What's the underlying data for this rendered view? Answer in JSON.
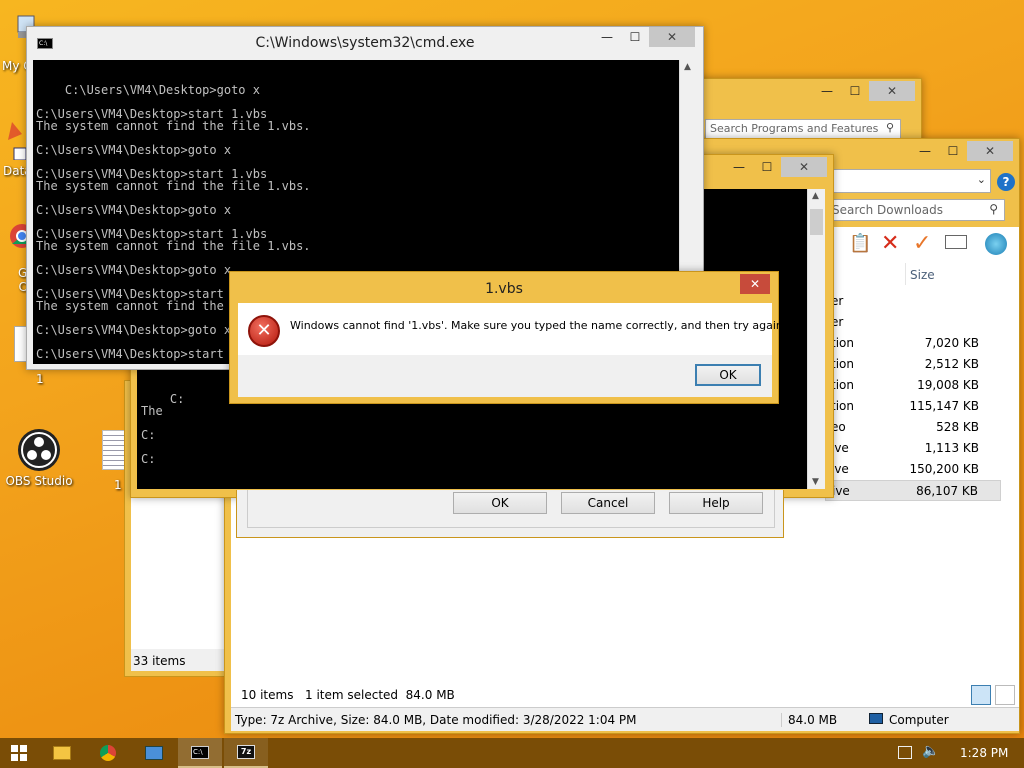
{
  "desktop": {
    "icons": [
      {
        "label": "My C",
        "icon": "computer-icon"
      },
      {
        "label": "Data",
        "icon": "shortcut-icon"
      },
      {
        "label": "G\nC",
        "icon": "chrome-icon"
      },
      {
        "label": "1",
        "icon": "file-icon"
      },
      {
        "label": "OBS Studio",
        "icon": "obs-icon"
      },
      {
        "label": "1",
        "icon": "text-file-icon"
      }
    ]
  },
  "cmd": {
    "title": "C:\\Windows\\system32\\cmd.exe",
    "lines": "C:\\Users\\VM4\\Desktop>goto x\n\nC:\\Users\\VM4\\Desktop>start 1.vbs\nThe system cannot find the file 1.vbs.\n\nC:\\Users\\VM4\\Desktop>goto x\n\nC:\\Users\\VM4\\Desktop>start 1.vbs\nThe system cannot find the file 1.vbs.\n\nC:\\Users\\VM4\\Desktop>goto x\n\nC:\\Users\\VM4\\Desktop>start 1.vbs\nThe system cannot find the file 1.vbs.\n\nC:\\Users\\VM4\\Desktop>goto x\n\nC:\\Users\\VM4\\Desktop>start 1.vbs\nThe system cannot find the file 1.vbs.\n\nC:\\Users\\VM4\\Desktop>goto x\n\nC:\\Users\\VM4\\Desktop>start 1.vbs"
  },
  "cmd_back": {
    "lines": "C:\nThe\n\nC:\n\nC:"
  },
  "programs": {
    "search_placeholder": "Search Programs and Features"
  },
  "explorer": {
    "search_placeholder": "Search Downloads",
    "size_header": "Size",
    "rows": [
      {
        "type": "er",
        "size": ""
      },
      {
        "type": "er",
        "size": ""
      },
      {
        "type": "tion",
        "size": "7,020 KB"
      },
      {
        "type": "tion",
        "size": "2,512 KB"
      },
      {
        "type": "tion",
        "size": "19,008 KB"
      },
      {
        "type": "tion",
        "size": "115,147 KB"
      },
      {
        "type": "eo",
        "size": "528 KB"
      },
      {
        "type": "ive",
        "size": "1,113 KB"
      },
      {
        "type": "ive",
        "size": "150,200 KB"
      },
      {
        "type": "ive",
        "size": "86,107 KB"
      }
    ],
    "status_items": "10 items",
    "status_selected": "1 item selected  84.0 MB",
    "details": "Type: 7z Archive, Size: 84.0 MB, Date modified: 3/28/2022 1:04 PM",
    "details_size": "84.0 MB",
    "details_location": "Computer"
  },
  "left_explorer": {
    "status_items": "33 items"
  },
  "dialog_back": {
    "ok": "OK",
    "cancel": "Cancel",
    "help": "Help"
  },
  "error_dialog": {
    "title": "1.vbs",
    "message": "Windows cannot find '1.vbs'. Make sure you typed the name correctly, and then try again.",
    "ok": "OK"
  },
  "taskbar": {
    "time": "1:28 PM",
    "items": [
      "file-explorer-icon",
      "chrome-icon",
      "control-panel-icon",
      "cmd-icon",
      "7zip-icon"
    ]
  },
  "colors": {
    "accent_frame": "#f0c04a",
    "close_red": "#c74b3b",
    "taskbar": "#7a4d06"
  }
}
